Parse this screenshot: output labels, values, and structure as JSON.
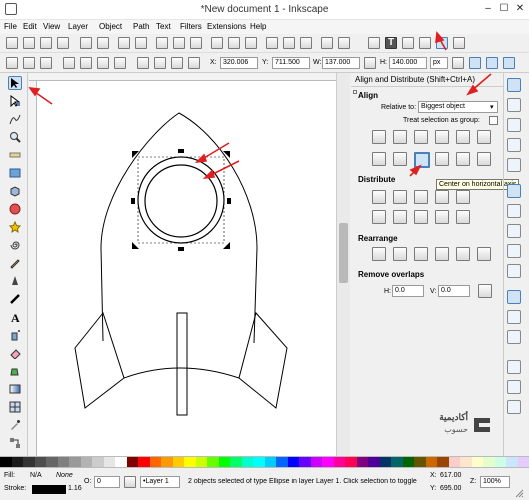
{
  "window": {
    "title": "*New document 1 - Inkscape",
    "minimize_icon": "minimize-icon",
    "maximize_icon": "maximize-icon",
    "close_icon": "close-icon"
  },
  "menu": [
    "File",
    "Edit",
    "View",
    "Layer",
    "Object",
    "Path",
    "Text",
    "Filters",
    "Extensions",
    "Help"
  ],
  "tool_controls": {
    "x_label": "X:",
    "x_value": "320.006",
    "y_label": "Y:",
    "y_value": "711.500",
    "w_label": "W:",
    "w_value": "137.000",
    "h_label": "H:",
    "h_value": "140.000",
    "unit": "px"
  },
  "dock": {
    "title": "Align and Distribute (Shift+Ctrl+A)",
    "align_header": "Align",
    "relative_to_label": "Relative to:",
    "relative_to_value": "Biggest object",
    "treat_group_label": "Treat selection as group:",
    "distribute_header": "Distribute",
    "rearrange_header": "Rearrange",
    "remove_overlaps_header": "Remove overlaps",
    "h_label": "H:",
    "h_value": "0.0",
    "v_label": "V:",
    "v_value": "0.0",
    "tooltip": "Center on horizontal axis"
  },
  "status": {
    "fill_label": "Fill:",
    "fill_value": "N/A",
    "fill_state": "None",
    "stroke_label": "Stroke:",
    "stroke_width": "1.16",
    "opacity_label": "O:",
    "opacity_value": "0",
    "layer_value": "•Layer 1",
    "message": "2 objects selected of type Ellipse in layer Layer 1. Click selection to toggle",
    "x_label": "X:",
    "x_value": "617.00",
    "y_label": "Y:",
    "y_value": "695.00",
    "z_label": "Z:",
    "zoom_value": "100%"
  },
  "watermark": {
    "arabic_top": "أكاديمية",
    "arabic_bottom": "حسوب"
  },
  "colors": {
    "accent": "#4a80b8",
    "annotation": "#e02020",
    "selection": "#000000"
  },
  "palette": [
    "#000000",
    "#1a1a1a",
    "#333333",
    "#4d4d4d",
    "#666666",
    "#808080",
    "#999999",
    "#b3b3b3",
    "#cccccc",
    "#e6e6e6",
    "#ffffff",
    "#800000",
    "#ff0000",
    "#ff6600",
    "#ff9900",
    "#ffcc00",
    "#ffff00",
    "#ccff00",
    "#66ff00",
    "#00ff00",
    "#00ff66",
    "#00ffcc",
    "#00ffff",
    "#00ccff",
    "#0066ff",
    "#0000ff",
    "#6600ff",
    "#cc00ff",
    "#ff00ff",
    "#ff0099",
    "#ff0055",
    "#800080",
    "#4d0099",
    "#003366",
    "#006666",
    "#006600",
    "#665500",
    "#cc6600",
    "#994400",
    "#ffcccc",
    "#ffe5cc",
    "#ffffcc",
    "#e5ffcc",
    "#ccffe5",
    "#cce5ff",
    "#e5ccff"
  ]
}
